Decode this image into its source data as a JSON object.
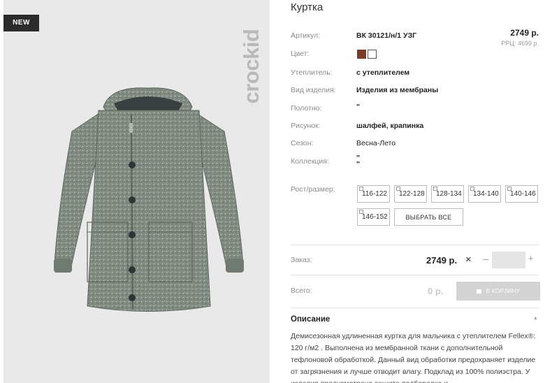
{
  "image": {
    "badge": "NEW",
    "brand": "crockid"
  },
  "product": {
    "title": "Куртка",
    "price": "2749 р.",
    "rrp": "РРЦ: 4699 р.",
    "attributes": [
      {
        "label": "Артикул:",
        "value": "ВК 30121/н/1 УЗГ"
      },
      {
        "label": "Цвет:",
        "value": ""
      },
      {
        "label": "Утеплитель:",
        "value": "с утеплителем"
      },
      {
        "label": "Вид изделия:",
        "value": "Изделия из мембраны"
      },
      {
        "label": "Полотно:",
        "value": "\""
      },
      {
        "label": "Рисунок:",
        "value": "шалфей, крапинка"
      },
      {
        "label": "Сезон:",
        "value": "Весна-Лето"
      },
      {
        "label": "Коллекция:",
        "value": "\"\n\""
      }
    ],
    "colors": [
      "#7a3b2a",
      "#ffffff"
    ],
    "sizes_label": "Рост/размер:",
    "sizes": [
      "116-122",
      "122-128",
      "128-134",
      "134-140",
      "140-146",
      "146-152"
    ],
    "select_all": "ВЫБРАТЬ ВСЕ"
  },
  "order": {
    "label": "Заказ:",
    "price": "2749 р.",
    "times": "×",
    "minus": "–",
    "plus": "+",
    "quantity": ""
  },
  "total": {
    "label": "Всего:",
    "value": "0 р.",
    "cart_button": "В КОРЗИНУ"
  },
  "description": {
    "title": "Описание",
    "text": "Демисезонная удлиненная куртка для мальчика с утеплителем Fellex®: 120 г/м2 . Выполнена из мембранной ткани с дополнительной тефлоновой обработкой. Данный вид обработки предохраняет изделие от загрязнения и лучше отводит влагу. Подклад из 100% полиэстра. У изделия предусмотрена защита подбородка и"
  }
}
